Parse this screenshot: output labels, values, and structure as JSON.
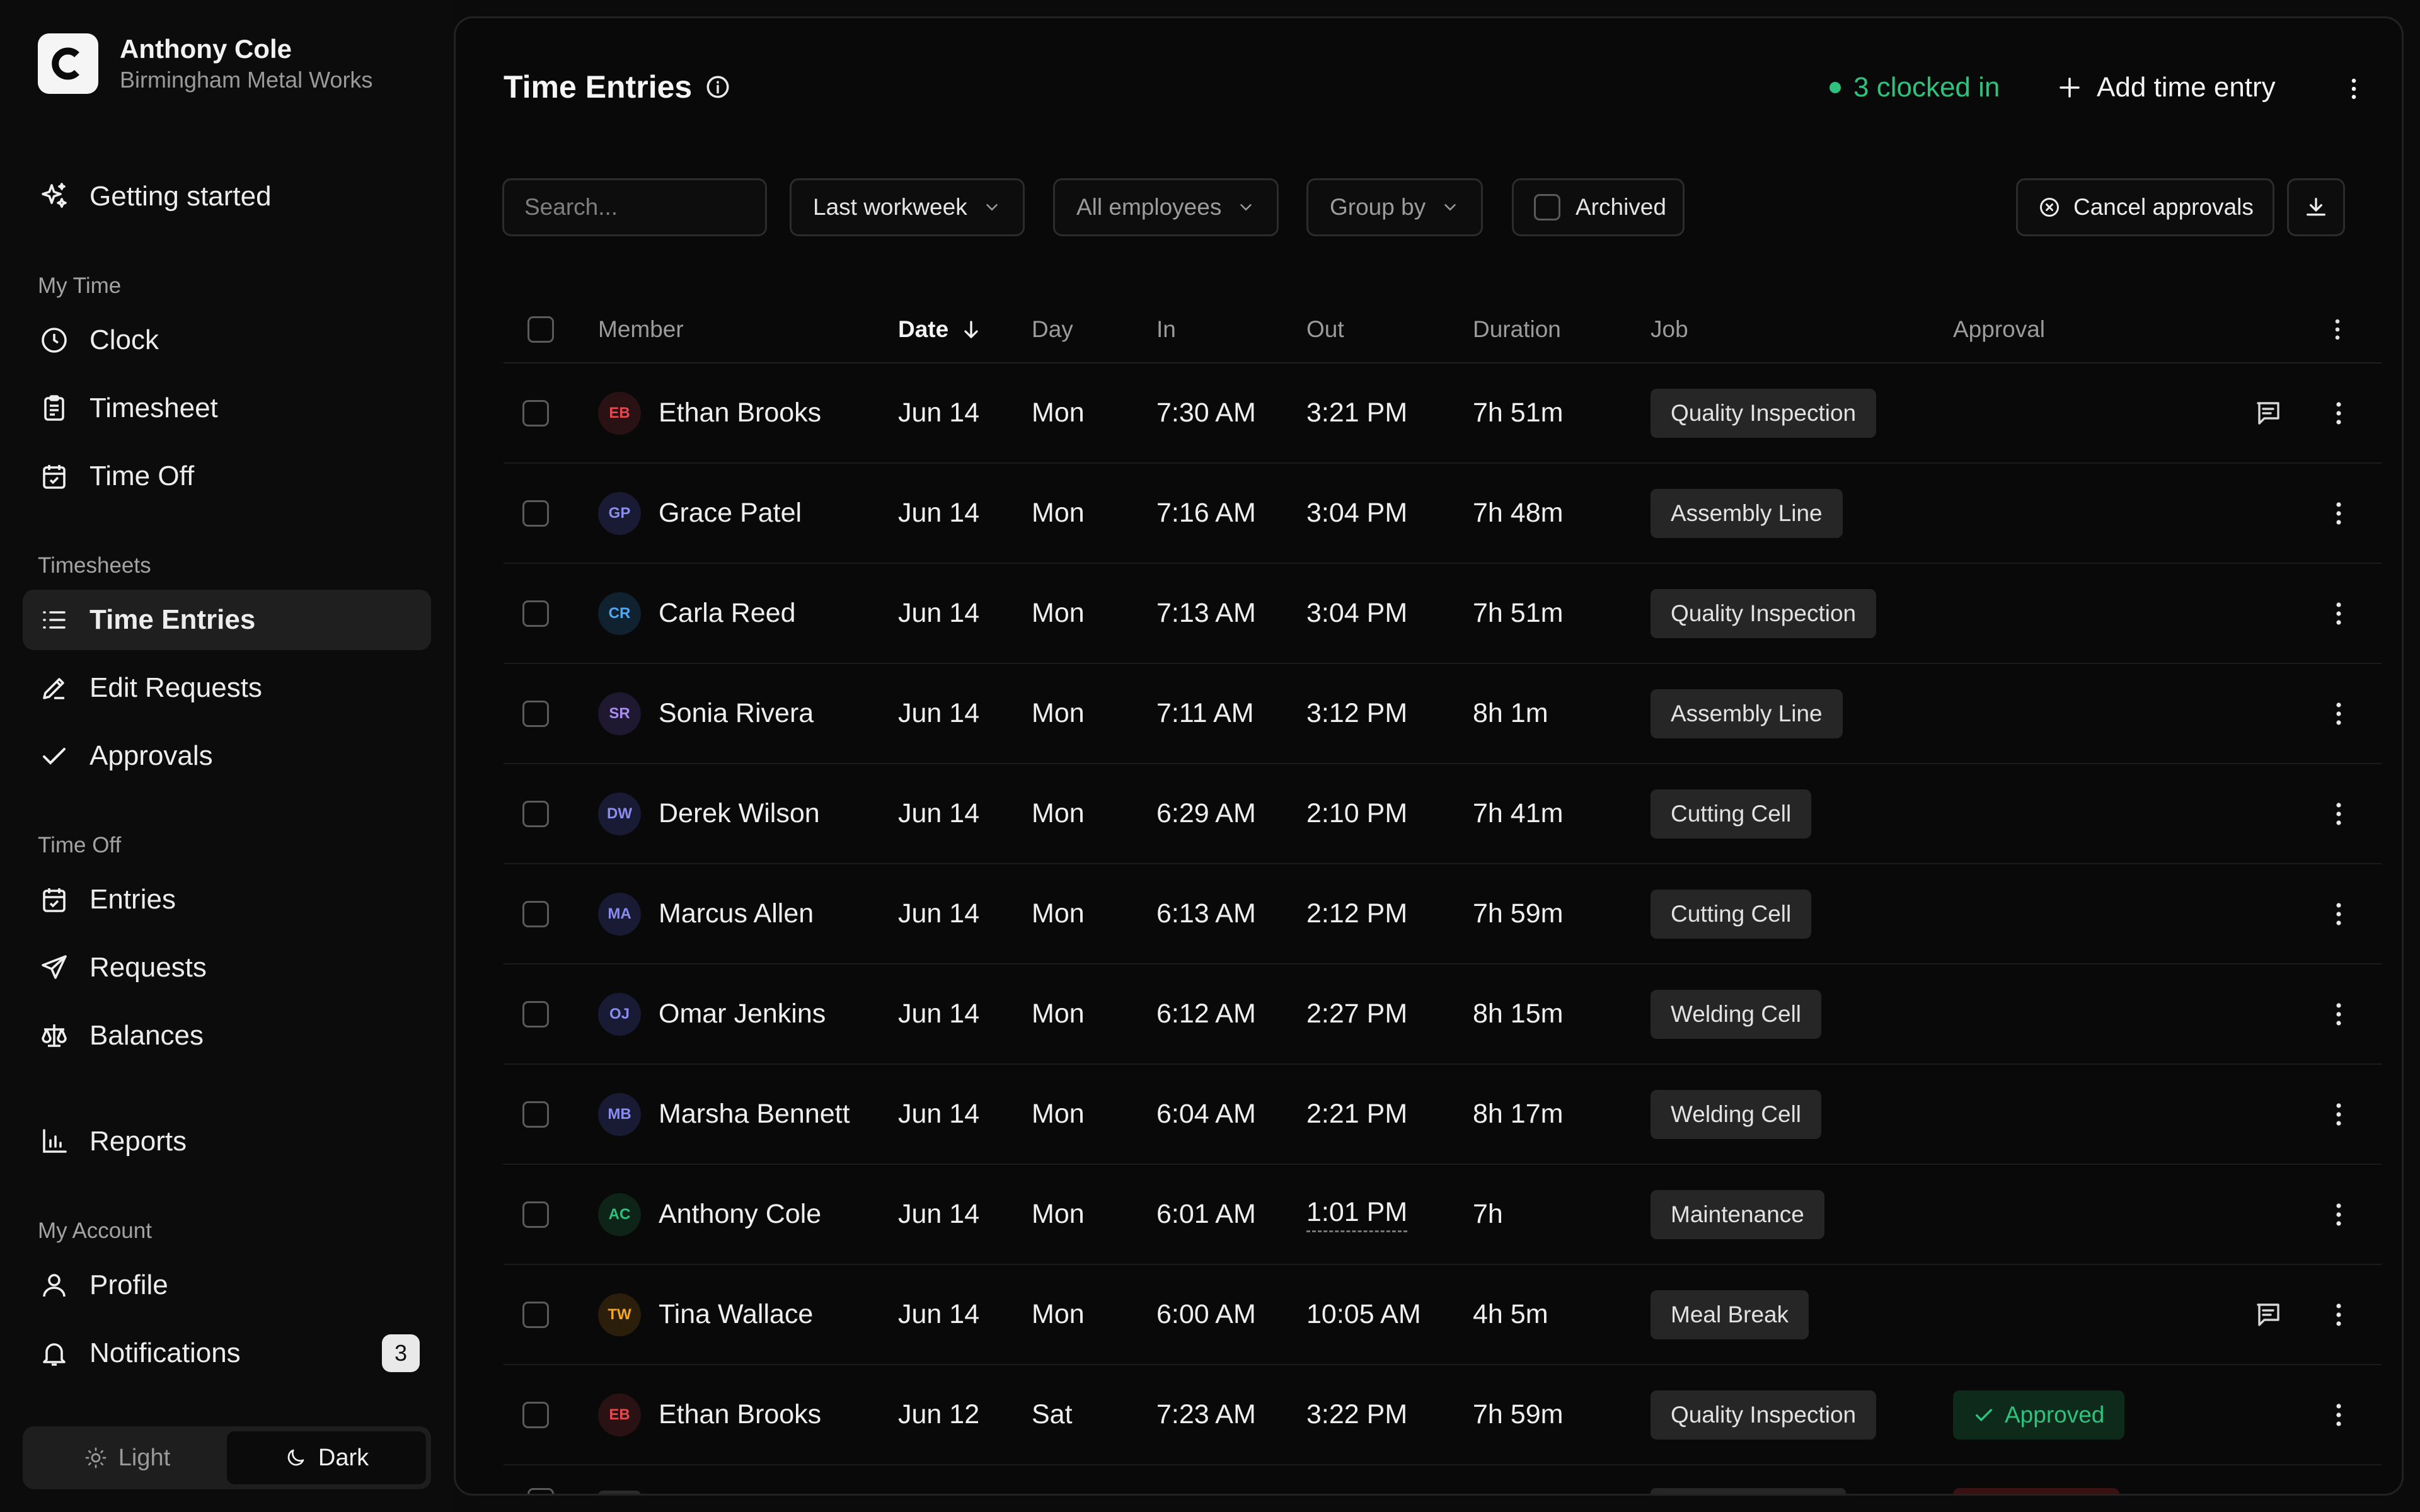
{
  "user": {
    "name": "Anthony Cole",
    "company": "Birmingham Metal Works",
    "logo_letter": "C"
  },
  "nav": {
    "getting_started": "Getting started",
    "sections": {
      "my_time": "My Time",
      "timesheets": "Timesheets",
      "time_off": "Time Off",
      "my_account": "My Account"
    },
    "clock": "Clock",
    "timesheet": "Timesheet",
    "time_off": "Time Off",
    "time_entries": "Time Entries",
    "edit_requests": "Edit Requests",
    "approvals": "Approvals",
    "entries": "Entries",
    "requests": "Requests",
    "balances": "Balances",
    "reports": "Reports",
    "profile": "Profile",
    "notifications": "Notifications",
    "notifications_count": "3"
  },
  "theme": {
    "light": "Light",
    "dark": "Dark",
    "selected": "Dark"
  },
  "header": {
    "title": "Time Entries",
    "clocked_in": "3 clocked in",
    "add_label": "Add time entry"
  },
  "filters": {
    "search_placeholder": "Search...",
    "date_range": "Last workweek",
    "employees": "All employees",
    "group_by": "Group by",
    "archived": "Archived",
    "cancel_approvals": "Cancel approvals"
  },
  "table": {
    "columns": {
      "member": "Member",
      "date": "Date",
      "day": "Day",
      "in": "In",
      "out": "Out",
      "duration": "Duration",
      "job": "Job",
      "approval": "Approval"
    },
    "rows": [
      {
        "initials": "EB",
        "member": "Ethan Brooks",
        "date": "Jun 14",
        "day": "Mon",
        "in": "7:30 AM",
        "out": "3:21 PM",
        "duration": "7h 51m",
        "job": "Quality Inspection",
        "approval": "",
        "note": true,
        "avatar_color": "#e5484d",
        "avatar_bg": "#2a1214"
      },
      {
        "initials": "GP",
        "member": "Grace Patel",
        "date": "Jun 14",
        "day": "Mon",
        "in": "7:16 AM",
        "out": "3:04 PM",
        "duration": "7h 48m",
        "job": "Assembly Line",
        "approval": "",
        "note": false,
        "avatar_color": "#8b8cf0",
        "avatar_bg": "#191a33"
      },
      {
        "initials": "CR",
        "member": "Carla Reed",
        "date": "Jun 14",
        "day": "Mon",
        "in": "7:13 AM",
        "out": "3:04 PM",
        "duration": "7h 51m",
        "job": "Quality Inspection",
        "approval": "",
        "note": false,
        "avatar_color": "#4ea8f5",
        "avatar_bg": "#10212f"
      },
      {
        "initials": "SR",
        "member": "Sonia Rivera",
        "date": "Jun 14",
        "day": "Mon",
        "in": "7:11 AM",
        "out": "3:12 PM",
        "duration": "8h 1m",
        "job": "Assembly Line",
        "approval": "",
        "note": false,
        "avatar_color": "#a88cf2",
        "avatar_bg": "#1e1830"
      },
      {
        "initials": "DW",
        "member": "Derek Wilson",
        "date": "Jun 14",
        "day": "Mon",
        "in": "6:29 AM",
        "out": "2:10 PM",
        "duration": "7h 41m",
        "job": "Cutting Cell",
        "approval": "",
        "note": false,
        "avatar_color": "#8b8cf0",
        "avatar_bg": "#191a33"
      },
      {
        "initials": "MA",
        "member": "Marcus Allen",
        "date": "Jun 14",
        "day": "Mon",
        "in": "6:13 AM",
        "out": "2:12 PM",
        "duration": "7h 59m",
        "job": "Cutting Cell",
        "approval": "",
        "note": false,
        "avatar_color": "#8b8cf0",
        "avatar_bg": "#191a33"
      },
      {
        "initials": "OJ",
        "member": "Omar Jenkins",
        "date": "Jun 14",
        "day": "Mon",
        "in": "6:12 AM",
        "out": "2:27 PM",
        "duration": "8h 15m",
        "job": "Welding Cell",
        "approval": "",
        "note": false,
        "avatar_color": "#8b8cf0",
        "avatar_bg": "#191a33"
      },
      {
        "initials": "MB",
        "member": "Marsha Bennett",
        "date": "Jun 14",
        "day": "Mon",
        "in": "6:04 AM",
        "out": "2:21 PM",
        "duration": "8h 17m",
        "job": "Welding Cell",
        "approval": "",
        "note": false,
        "avatar_color": "#8b8cf0",
        "avatar_bg": "#191a33"
      },
      {
        "initials": "AC",
        "member": "Anthony Cole",
        "date": "Jun 14",
        "day": "Mon",
        "in": "6:01 AM",
        "out": "1:01 PM",
        "duration": "7h",
        "job": "Maintenance",
        "approval": "",
        "note": false,
        "dashed_out": true,
        "avatar_color": "#2ec27e",
        "avatar_bg": "#0f2419"
      },
      {
        "initials": "TW",
        "member": "Tina Wallace",
        "date": "Jun 14",
        "day": "Mon",
        "in": "6:00 AM",
        "out": "10:05 AM",
        "duration": "4h 5m",
        "job": "Meal Break",
        "approval": "",
        "note": true,
        "avatar_color": "#f5a524",
        "avatar_bg": "#2b1f0c"
      },
      {
        "initials": "EB",
        "member": "Ethan Brooks",
        "date": "Jun 12",
        "day": "Sat",
        "in": "7:23 AM",
        "out": "3:22 PM",
        "duration": "7h 59m",
        "job": "Quality Inspection",
        "approval": "Approved",
        "note": false,
        "avatar_color": "#e5484d",
        "avatar_bg": "#2a1214"
      }
    ]
  },
  "colors": {
    "accent_green": "#2ec27e",
    "background": "#0b0b0b",
    "tag_bg": "#262626"
  }
}
